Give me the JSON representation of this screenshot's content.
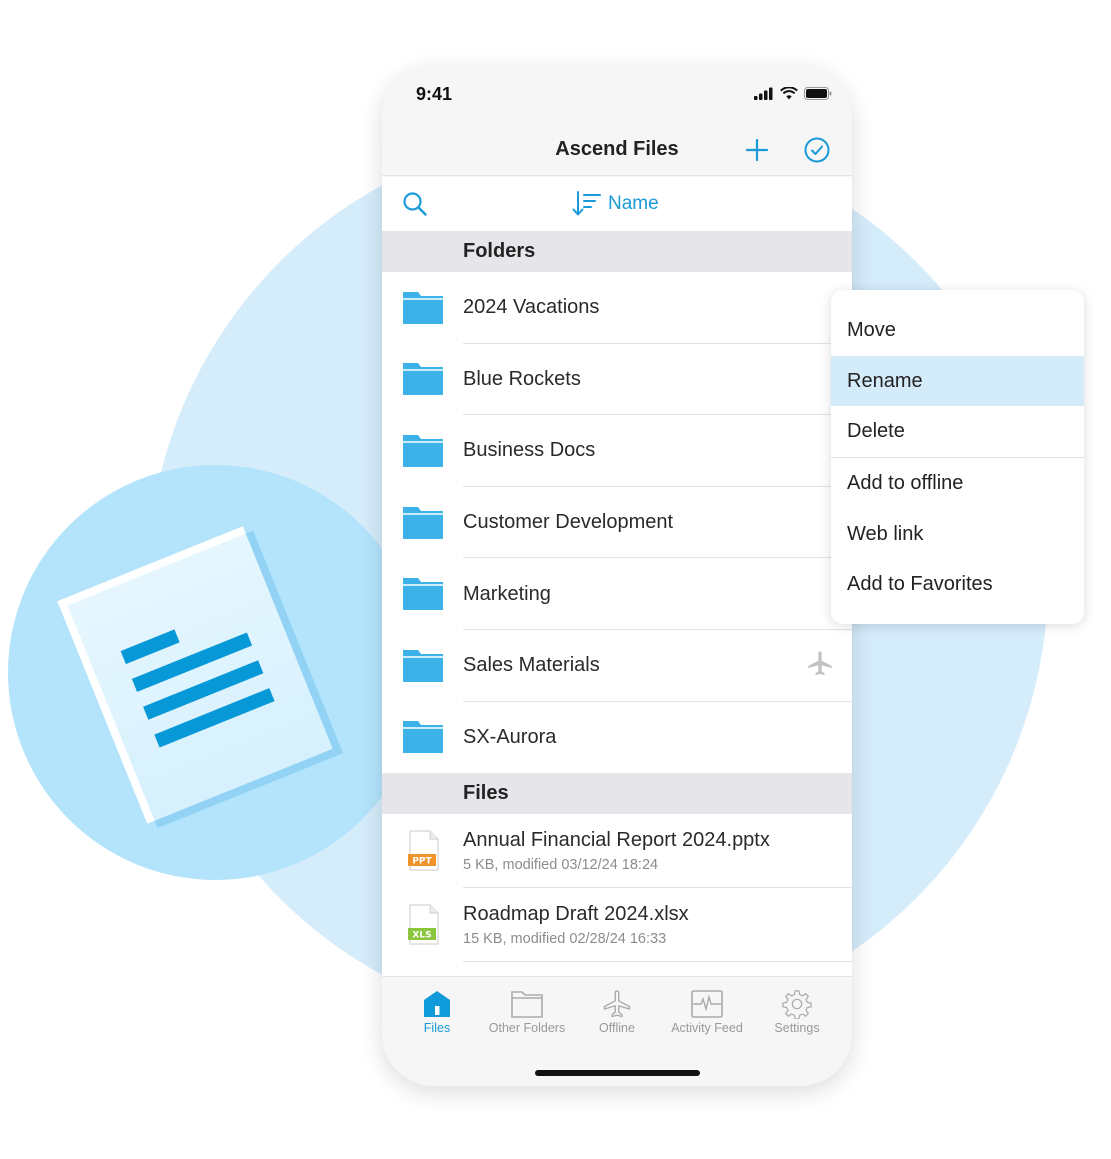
{
  "colors": {
    "accent": "#1a9ad6",
    "folder": "#3db2e8",
    "ppt_badge": "#f0932b",
    "xls_badge": "#8cc63f",
    "highlight": "#d4ebfa",
    "section_bg": "#e6e6ea"
  },
  "status_bar": {
    "time": "9:41"
  },
  "navbar": {
    "title": "Ascend Files",
    "add_icon": "plus-icon",
    "select_icon": "checkmark-circle-icon"
  },
  "toolbar": {
    "search_icon": "search-icon",
    "sort_label": "Name",
    "sort_icon": "sort-descending-icon"
  },
  "folders_section": {
    "title": "Folders",
    "items": [
      {
        "name": "2024 Vacations",
        "offline": false
      },
      {
        "name": "Blue Rockets",
        "offline": false
      },
      {
        "name": "Business Docs",
        "offline": false
      },
      {
        "name": "Customer Development",
        "offline": false
      },
      {
        "name": "Marketing",
        "offline": false
      },
      {
        "name": "Sales Materials",
        "offline": true
      },
      {
        "name": "SX-Aurora",
        "offline": false
      }
    ]
  },
  "files_section": {
    "title": "Files",
    "items": [
      {
        "name": "Annual Financial Report 2024.pptx",
        "meta": "5 KB, modified 03/12/24 18:24",
        "badge": "PPT"
      },
      {
        "name": "Roadmap Draft 2024.xlsx",
        "meta": "15 KB, modified 02/28/24 16:33",
        "badge": "XLS"
      }
    ]
  },
  "tabbar": {
    "tabs": [
      {
        "label": "Files",
        "icon": "home-icon",
        "active": true
      },
      {
        "label": "Other Folders",
        "icon": "folder-icon",
        "active": false
      },
      {
        "label": "Offline",
        "icon": "airplane-icon",
        "active": false
      },
      {
        "label": "Activity Feed",
        "icon": "activity-icon",
        "active": false
      },
      {
        "label": "Settings",
        "icon": "gear-icon",
        "active": false
      }
    ]
  },
  "context_menu": {
    "items": [
      {
        "label": "Move",
        "highlighted": false
      },
      {
        "label": "Rename",
        "highlighted": true
      },
      {
        "label": "Delete",
        "highlighted": false
      },
      {
        "label": "Add to offline",
        "highlighted": false
      },
      {
        "label": "Web link",
        "highlighted": false
      },
      {
        "label": "Add to Favorites",
        "highlighted": false
      }
    ]
  }
}
